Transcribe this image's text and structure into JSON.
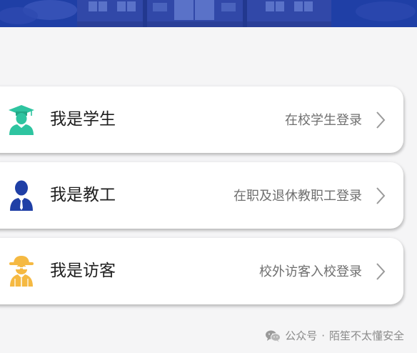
{
  "colors": {
    "banner": "#1f3fa6",
    "student_icon": "#2ec4a0",
    "staff_icon": "#1f3fa6",
    "visitor_icon": "#f5b942"
  },
  "roles": [
    {
      "title": "我是学生",
      "description": "在校学生登录",
      "icon": "student-graduate-icon"
    },
    {
      "title": "我是教工",
      "description": "在职及退休教职工登录",
      "icon": "staff-person-icon"
    },
    {
      "title": "我是访客",
      "description": "校外访客入校登录",
      "icon": "visitor-detective-icon"
    }
  ],
  "footer": {
    "prefix": "公众号",
    "separator": "·",
    "account": "陌笙不太懂安全"
  }
}
